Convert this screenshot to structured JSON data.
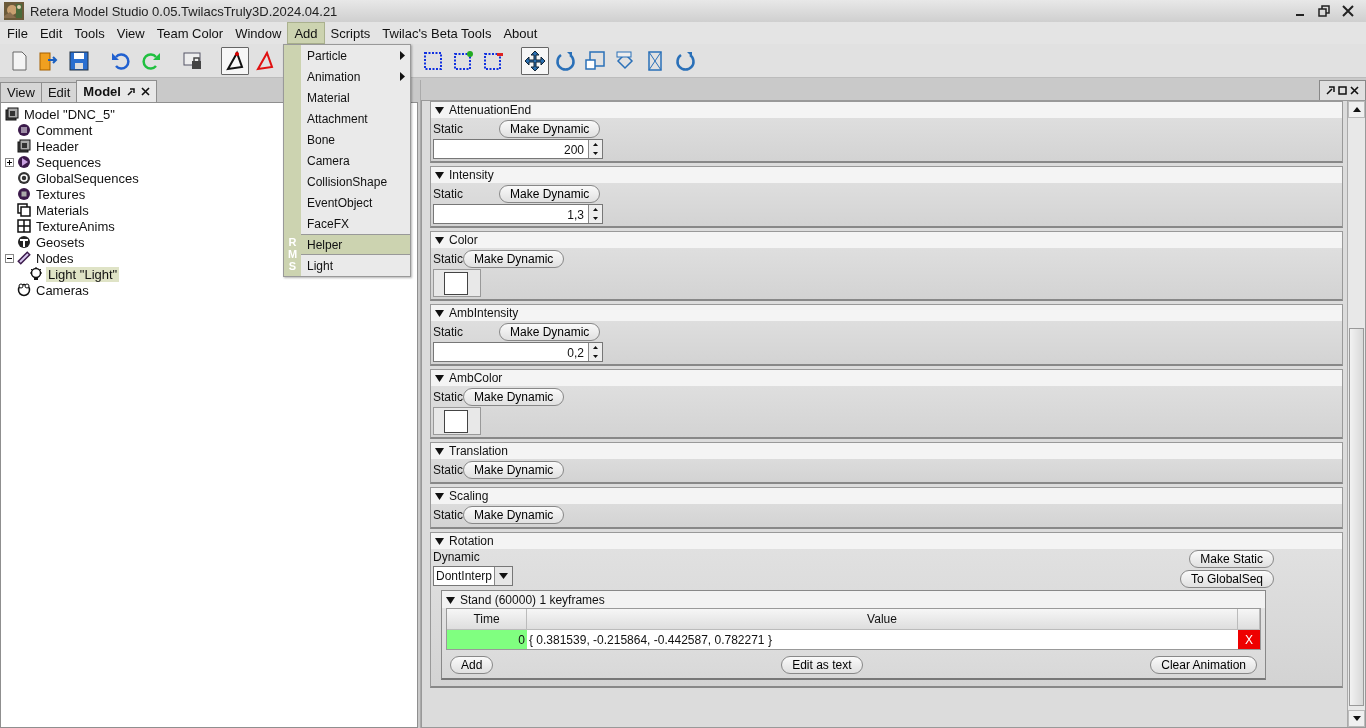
{
  "window": {
    "title": "Retera Model Studio 0.05.TwilacsTruly3D.2024.04.21"
  },
  "menu": [
    {
      "label": "File",
      "selected": false
    },
    {
      "label": "Edit",
      "selected": false
    },
    {
      "label": "Tools",
      "selected": false
    },
    {
      "label": "View",
      "selected": false
    },
    {
      "label": "Team Color",
      "selected": false
    },
    {
      "label": "Window",
      "selected": false
    },
    {
      "label": "Add",
      "selected": true
    },
    {
      "label": "Scripts",
      "selected": false
    },
    {
      "label": "Twilac's Beta Tools",
      "selected": false
    },
    {
      "label": "About",
      "selected": false
    }
  ],
  "add_menu": {
    "side_label": "RMS",
    "items": [
      {
        "label": "Particle",
        "submenu": true,
        "selected": false
      },
      {
        "label": "Animation",
        "submenu": true,
        "selected": false
      },
      {
        "label": "Material",
        "submenu": false,
        "selected": false
      },
      {
        "label": "Attachment",
        "submenu": false,
        "selected": false
      },
      {
        "label": "Bone",
        "submenu": false,
        "selected": false
      },
      {
        "label": "Camera",
        "submenu": false,
        "selected": false
      },
      {
        "label": "CollisionShape",
        "submenu": false,
        "selected": false
      },
      {
        "label": "EventObject",
        "submenu": false,
        "selected": false
      },
      {
        "label": "FaceFX",
        "submenu": false,
        "selected": false
      },
      {
        "label": "Helper",
        "submenu": false,
        "selected": true
      },
      {
        "label": "Light",
        "submenu": false,
        "selected": false
      }
    ]
  },
  "toolbar": [
    {
      "kind": "new",
      "selected": false
    },
    {
      "kind": "open",
      "selected": false
    },
    {
      "kind": "save",
      "selected": false
    },
    {
      "kind": "gap"
    },
    {
      "kind": "undo",
      "selected": false
    },
    {
      "kind": "redo",
      "selected": false
    },
    {
      "kind": "gap"
    },
    {
      "kind": "lock",
      "selected": false
    },
    {
      "kind": "gap"
    },
    {
      "kind": "triangle-dark",
      "selected": true
    },
    {
      "kind": "triangle-red",
      "selected": false
    },
    {
      "kind": "hidden"
    },
    {
      "kind": "select",
      "selected": false
    },
    {
      "kind": "select-add",
      "selected": false
    },
    {
      "kind": "select-remove",
      "selected": false
    },
    {
      "kind": "gap"
    },
    {
      "kind": "move",
      "selected": true
    },
    {
      "kind": "rotate",
      "selected": false
    },
    {
      "kind": "scale",
      "selected": false
    },
    {
      "kind": "extrude",
      "selected": false
    },
    {
      "kind": "stretch",
      "selected": false
    },
    {
      "kind": "rotate",
      "selected": false
    }
  ],
  "tabs": [
    {
      "label": "View",
      "selected": false
    },
    {
      "label": "Edit",
      "selected": false
    },
    {
      "label": "Model",
      "selected": true
    }
  ],
  "tree": {
    "label": "Model \"DNC_5\"",
    "kind": "cube",
    "selected": false,
    "children": [
      {
        "label": "Comment",
        "kind": "lines",
        "selected": false
      },
      {
        "label": "Header",
        "kind": "cube",
        "selected": false
      },
      {
        "label": "Sequences",
        "kind": "play",
        "selected": false,
        "expanded": false
      },
      {
        "label": "GlobalSequences",
        "kind": "globe",
        "selected": false
      },
      {
        "label": "Textures",
        "kind": "square",
        "selected": false
      },
      {
        "label": "Materials",
        "kind": "pages",
        "selected": false
      },
      {
        "label": "TextureAnims",
        "kind": "grid",
        "selected": false
      },
      {
        "label": "Geosets",
        "kind": "figure",
        "selected": false
      },
      {
        "label": "Nodes",
        "kind": "bone",
        "selected": false,
        "expanded": true,
        "children": [
          {
            "label": "Light \"Light\"",
            "kind": "bulb",
            "selected": true
          }
        ]
      },
      {
        "label": "Cameras",
        "kind": "camera",
        "selected": false
      }
    ]
  },
  "sections": [
    {
      "title": "AttenuationEnd",
      "expanded": true,
      "kind": "number",
      "mode": "Static",
      "button": "Make Dynamic",
      "value": "200"
    },
    {
      "title": "Intensity",
      "expanded": true,
      "kind": "number",
      "mode": "Static",
      "button": "Make Dynamic",
      "value": "1,3"
    },
    {
      "title": "Color",
      "expanded": true,
      "kind": "color",
      "mode": "Static",
      "button": "Make Dynamic",
      "color": "#ffffff"
    },
    {
      "title": "AmbIntensity",
      "expanded": true,
      "kind": "number",
      "mode": "Static",
      "button": "Make Dynamic",
      "value": "0,2"
    },
    {
      "title": "AmbColor",
      "expanded": true,
      "kind": "color",
      "mode": "Static",
      "button": "Make Dynamic",
      "color": "#ffffff"
    },
    {
      "title": "Translation",
      "expanded": true,
      "kind": "plain",
      "mode": "Static",
      "button": "Make Dynamic"
    },
    {
      "title": "Scaling",
      "expanded": true,
      "kind": "plain",
      "mode": "Static",
      "button": "Make Dynamic"
    },
    {
      "title": "Rotation",
      "expanded": true,
      "kind": "animated",
      "mode": "Dynamic",
      "interpolation": "DontInterp",
      "buttons": [
        "Make Static",
        "To GlobalSeq"
      ],
      "track": {
        "title": "Stand (60000) 1 keyframes",
        "expanded": true,
        "columns": [
          "Time",
          "Value"
        ],
        "rows": [
          {
            "time": "0",
            "value": "{ 0.381539, -0.215864, -0.442587, 0.782271 }",
            "delete": "X"
          }
        ],
        "buttons": [
          "Add",
          "Edit as text",
          "Clear Animation"
        ]
      }
    }
  ]
}
